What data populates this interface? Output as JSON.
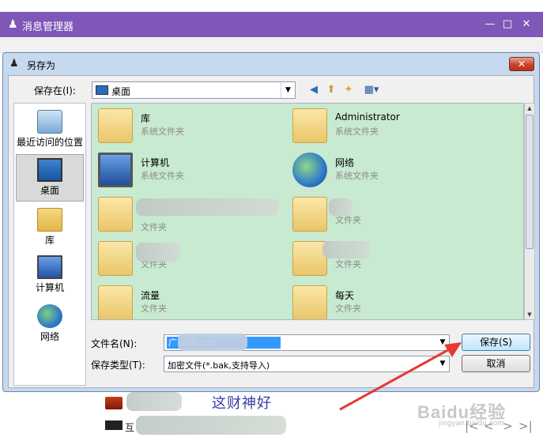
{
  "background_window": {
    "title": "消息管理器",
    "controls": [
      "—",
      "□",
      "✕"
    ],
    "footer_text": "互",
    "slogan": "这财神好",
    "nav": [
      "|<",
      "<",
      ">",
      ">|"
    ],
    "watermark": "Baidu经验",
    "watermark_sub": "jingyan.baidu.com"
  },
  "dialog": {
    "title": "另存为",
    "close_label": "✕",
    "save_in_label": "保存在(I):",
    "save_in_value": "桌面",
    "places": [
      {
        "label": "最近访问的位置",
        "icon": "recent-places-icon"
      },
      {
        "label": "桌面",
        "icon": "desktop-icon"
      },
      {
        "label": "库",
        "icon": "library-icon"
      },
      {
        "label": "计算机",
        "icon": "computer-icon"
      },
      {
        "label": "网络",
        "icon": "network-icon"
      }
    ],
    "items": [
      {
        "name": "库",
        "type": "系统文件夹"
      },
      {
        "name": "Administrator",
        "type": "系统文件夹"
      },
      {
        "name": "计算机",
        "type": "系统文件夹"
      },
      {
        "name": "网络",
        "type": "系统文件夹"
      },
      {
        "name": "",
        "type": "文件夹"
      },
      {
        "name": "",
        "type": "文件夹"
      },
      {
        "name": "",
        "type": "文件夹"
      },
      {
        "name": "",
        "type": "文件夹"
      },
      {
        "name": "流量",
        "type": "文件夹"
      },
      {
        "name": "每天",
        "type": "文件夹"
      }
    ],
    "filename_label": "文件名(N):",
    "filename_value": "广                    带群.bak",
    "filetype_label": "保存类型(T):",
    "filetype_value": "加密文件(*.bak,支持导入)",
    "save_button": "保存(S)",
    "cancel_button": "取消"
  },
  "colors": {
    "dialog_frame": "#c6d9ee",
    "file_list_bg": "#c8ead0",
    "annotation_arrow": "#e53935"
  }
}
